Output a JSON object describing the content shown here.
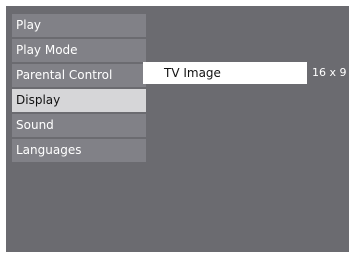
{
  "menu": {
    "items": [
      {
        "label": "Play",
        "selected": false
      },
      {
        "label": "Play Mode",
        "selected": false
      },
      {
        "label": "Parental Control",
        "selected": false
      },
      {
        "label": "Display",
        "selected": true
      },
      {
        "label": "Sound",
        "selected": false
      },
      {
        "label": "Languages",
        "selected": false
      }
    ]
  },
  "submenu": {
    "item_label": "TV  Image",
    "value": "16 x 9"
  },
  "colors": {
    "background": "#6b6b70",
    "menu_item": "#818187",
    "selected_item": "#d6d6d8",
    "highlight": "#ffffff"
  }
}
